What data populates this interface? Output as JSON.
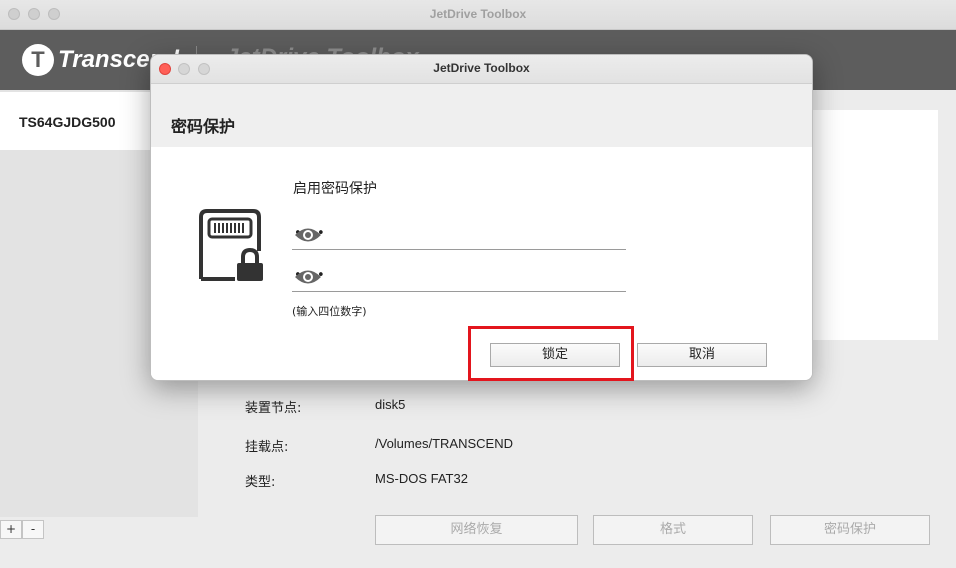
{
  "window": {
    "title": "JetDrive Toolbox"
  },
  "brand": {
    "logo_letter": "T",
    "name": "Transcend",
    "app_name": "JetDrive Toolbox"
  },
  "sidebar": {
    "device": "TS64GJDG500",
    "add_label": "+",
    "remove_label": "-"
  },
  "info": {
    "rows": [
      {
        "label": "装置节点:",
        "value": "disk5"
      },
      {
        "label": "挂载点:",
        "value": "/Volumes/TRANSCEND"
      },
      {
        "label": "类型:",
        "value": "MS-DOS FAT32"
      }
    ]
  },
  "bottom_buttons": {
    "recover": "网络恢复",
    "format": "格式",
    "password": "密码保护"
  },
  "dialog": {
    "title": "JetDrive Toolbox",
    "heading": "密码保护",
    "enable_label": "启用密码保护",
    "password1": "••••",
    "password2": "••••",
    "hint": "(输入四位数字)",
    "lock_button": "锁定",
    "cancel_button": "取消"
  },
  "colors": {
    "close": "#ff5f57",
    "highlight": "#e3151d",
    "brand_bar": "#5d5d5d"
  },
  "icons": [
    "lock-drive-icon",
    "eye-icon"
  ]
}
